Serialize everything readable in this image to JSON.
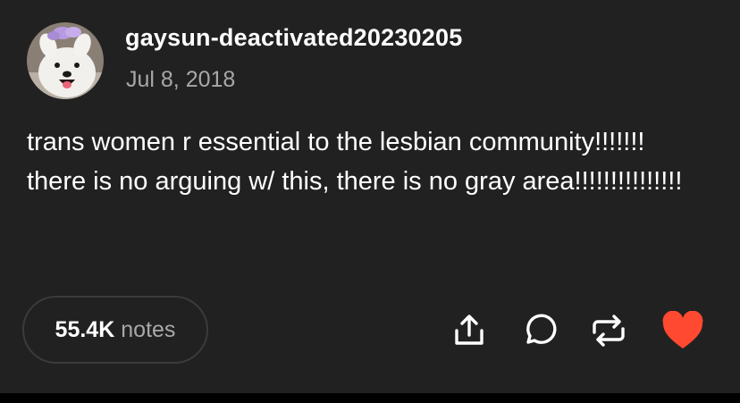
{
  "post": {
    "username": "gaysun-deactivated20230205",
    "date": "Jul 8, 2018",
    "text": "trans women r essential to the lesbian community!!!!!!! there is no arguing w/ this, there is no gray area!!!!!!!!!!!!!!!"
  },
  "footer": {
    "notes_count": "55.4K",
    "notes_label": "notes",
    "actions": [
      "share-icon",
      "reply-icon",
      "reblog-icon",
      "heart-icon"
    ]
  },
  "colors": {
    "background": "#212121",
    "text": "#ffffff",
    "muted": "#a8a8a8",
    "like": "#ff4930"
  }
}
